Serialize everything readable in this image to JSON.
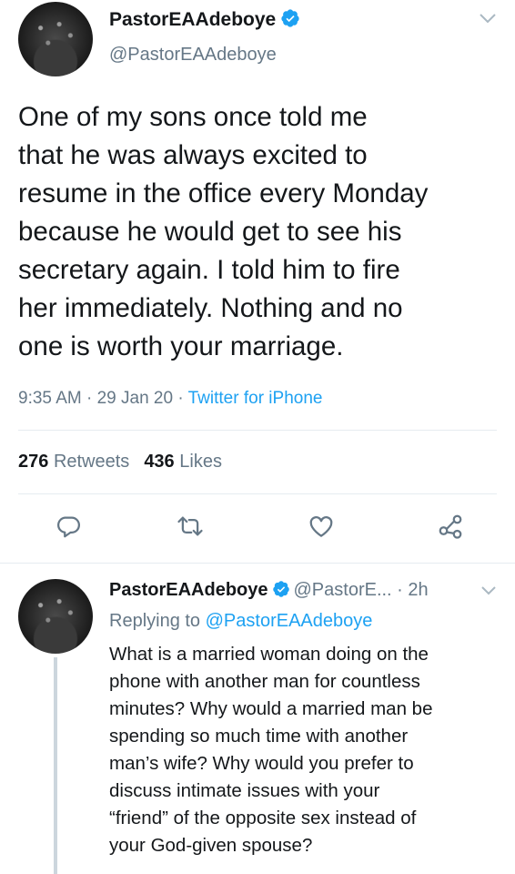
{
  "tweet": {
    "display_name": "PastorEAAdeboye",
    "handle": "@PastorEAAdeboye",
    "text": "One of my sons once told me\nthat he was always excited to\nresume in the office every Monday\nbecause he would get to see his\nsecretary again. I told him to fire\nher immediately. Nothing and no\none is worth your marriage.",
    "time": "9:35 AM",
    "date": "29 Jan 20",
    "source": "Twitter for iPhone",
    "retweets_count": "276",
    "retweets_label": "Retweets",
    "likes_count": "436",
    "likes_label": "Likes"
  },
  "reply": {
    "display_name": "PastorEAAdeboye",
    "handle": "@PastorE...",
    "time": "2h",
    "replying_prefix": "Replying to",
    "replying_to": "@PastorEAAdeboye",
    "text": "What is a married woman doing on the\nphone with another man for countless\nminutes? Why would a married man be\nspending so much time with another\nman’s wife? Why would you prefer to\ndiscuss intimate issues with your\n“friend” of the opposite sex instead of\nyour God-given spouse?"
  },
  "icons": {
    "verified": "verified-badge-icon",
    "more": "chevron-down-icon",
    "reply": "reply-icon",
    "retweet": "retweet-icon",
    "like": "heart-icon",
    "share": "share-icon"
  },
  "colors": {
    "accent": "#1da1f2",
    "secondary_text": "#657786",
    "primary_text": "#14171a",
    "divider": "#e6ecf0",
    "thread_line": "#ccd6dd"
  }
}
